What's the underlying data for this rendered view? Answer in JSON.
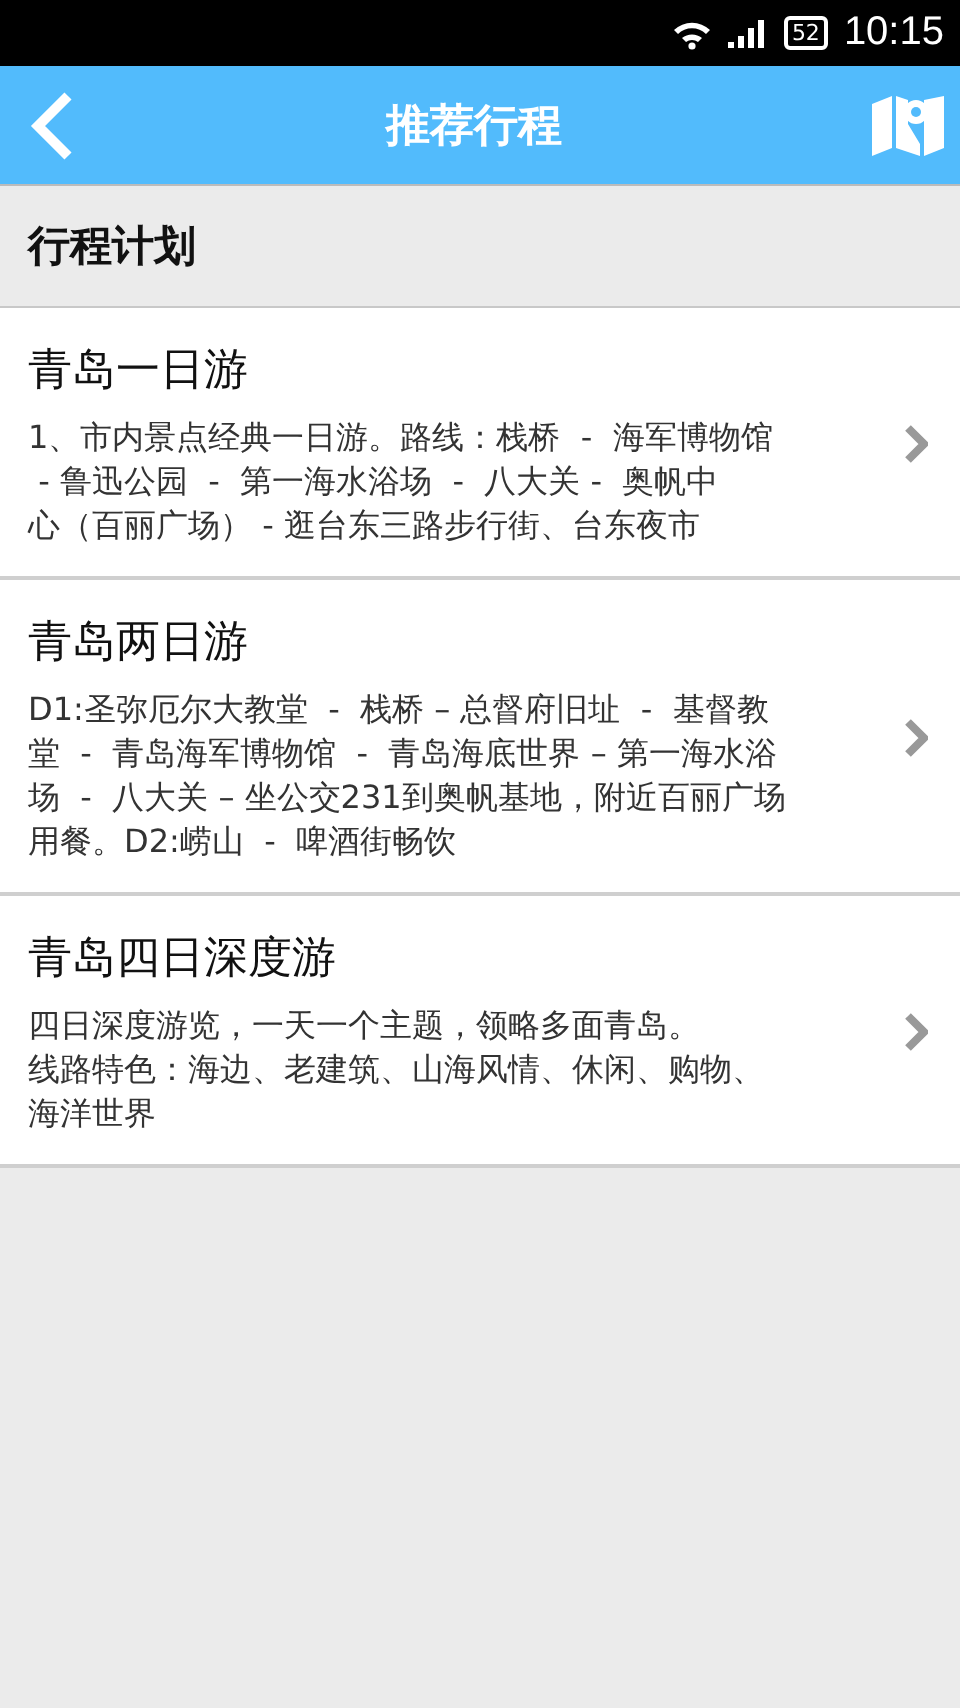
{
  "status_bar": {
    "battery": "52",
    "time": "10:15"
  },
  "app_bar": {
    "title": "推荐行程"
  },
  "section": {
    "title": "行程计划"
  },
  "routes": [
    {
      "title": "青岛一日游",
      "lines": [
        "1、市内景点经典一日游。路线：栈桥  -  海军博物馆",
        " - 鲁迅公园  -  第一海水浴场  -  八大关 -  奥帆中",
        "心（百丽广场） - 逛台东三路步行街、台东夜市"
      ]
    },
    {
      "title": "青岛两日游",
      "lines": [
        "D1:圣弥厄尔大教堂  -  栈桥 – 总督府旧址  -  基督教",
        "堂  -  青岛海军博物馆  -  青岛海底世界 – 第一海水浴",
        "场  -  八大关 – 坐公交231到奥帆基地，附近百丽广场",
        "用餐。D2:崂山  -  啤酒街畅饮"
      ]
    },
    {
      "title": "青岛四日深度游",
      "lines": [
        "四日深度游览，一天一个主题，领略多面青岛。",
        "线路特色：海边、老建筑、山海风情、休闲、购物、",
        "海洋世界"
      ]
    }
  ]
}
